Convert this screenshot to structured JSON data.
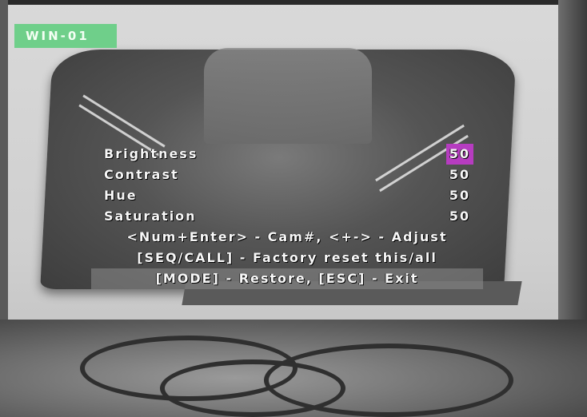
{
  "window_label": "WIN-01",
  "menu": {
    "items": [
      {
        "label": "Brightness",
        "value": "50",
        "selected": true
      },
      {
        "label": "Contrast",
        "value": "50",
        "selected": false
      },
      {
        "label": "Hue",
        "value": "50",
        "selected": false
      },
      {
        "label": "Saturation",
        "value": "50",
        "selected": false
      }
    ],
    "help_lines": [
      "<Num+Enter> - Cam#, <+-> - Adjust",
      "[SEQ/CALL] - Factory reset this/all",
      "[MODE] - Restore, [ESC] - Exit"
    ]
  },
  "colors": {
    "label_bg": "#6fcf8a",
    "selection_bg": "#b63cc0"
  }
}
